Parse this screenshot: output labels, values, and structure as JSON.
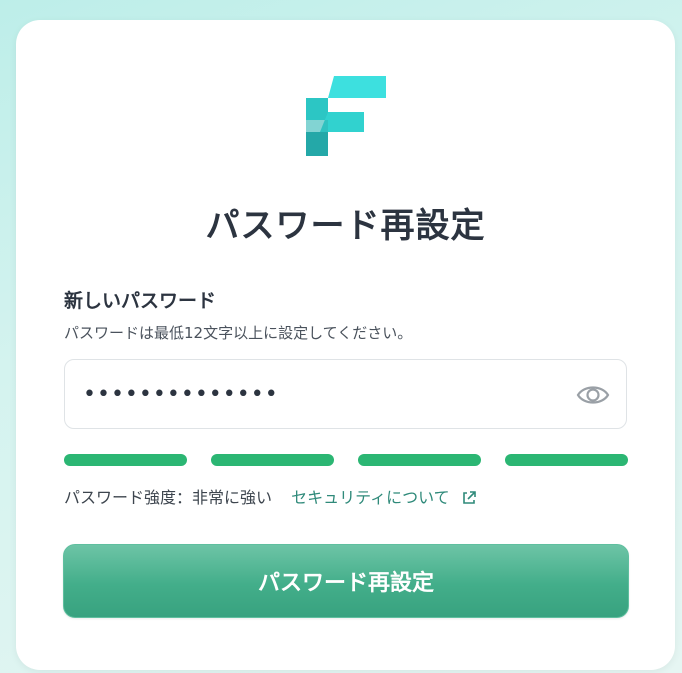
{
  "page": {
    "title": "パスワード再設定"
  },
  "form": {
    "label": "新しいパスワード",
    "help": "パスワードは最低12文字以上に設定してください。",
    "password_value": "••••••••••••••",
    "show_password_icon": "eye-icon"
  },
  "strength": {
    "segments_filled": 4,
    "segments_total": 4,
    "color": "#2bb673",
    "text": "パスワード強度：非常に強い",
    "link_text": "セキュリティについて",
    "link_icon": "external-link-icon"
  },
  "submit": {
    "label": "パスワード再設定"
  },
  "colors": {
    "logo_light": "#3de0df",
    "logo_mid": "#2cc6c4",
    "logo_dark": "#24a8a8",
    "accent": "#43ae8a",
    "link": "#2f8a7a"
  }
}
